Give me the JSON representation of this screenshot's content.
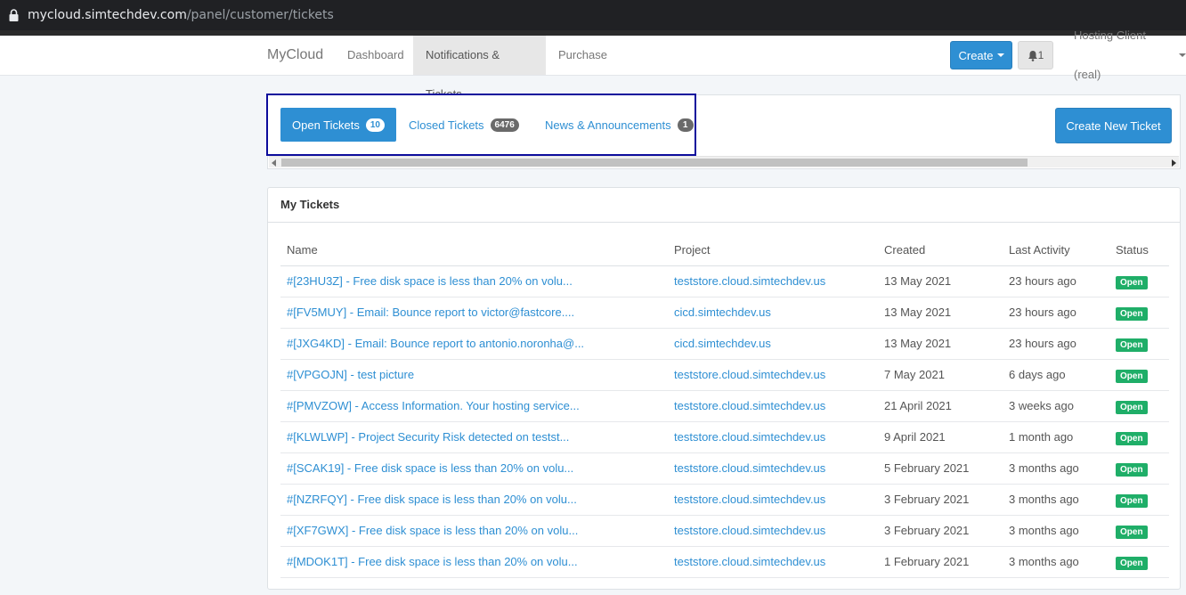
{
  "browser": {
    "url_host": "mycloud.simtechdev.com",
    "url_path": "/panel/customer/tickets"
  },
  "nav": {
    "brand": "MyCloud",
    "links": [
      "Dashboard",
      "Notifications & Tickets",
      "Purchase"
    ],
    "active_link": "Notifications & Tickets",
    "create_label": "Create",
    "bell_count": "1",
    "user_label": "Hosting Client (real)"
  },
  "tabs": {
    "items": [
      {
        "label": "Open Tickets",
        "count": "10",
        "active": true
      },
      {
        "label": "Closed Tickets",
        "count": "6476",
        "active": false
      },
      {
        "label": "News & Announcements",
        "count": "1",
        "active": false
      }
    ],
    "new_ticket_label": "Create New Ticket"
  },
  "tickets": {
    "heading": "My Tickets",
    "columns": [
      "Name",
      "Project",
      "Created",
      "Last Activity",
      "Status"
    ],
    "rows": [
      {
        "name": "#[23HU3Z] - Free disk space is less than 20% on volu...",
        "project": "teststore.cloud.simtechdev.us",
        "created": "13 May 2021",
        "last_activity": "23 hours ago",
        "status": "Open"
      },
      {
        "name": "#[FV5MUY] - Email: Bounce report to victor@fastcore....",
        "project": "cicd.simtechdev.us",
        "created": "13 May 2021",
        "last_activity": "23 hours ago",
        "status": "Open"
      },
      {
        "name": "#[JXG4KD] - Email: Bounce report to antonio.noronha@...",
        "project": "cicd.simtechdev.us",
        "created": "13 May 2021",
        "last_activity": "23 hours ago",
        "status": "Open"
      },
      {
        "name": "#[VPGOJN] - test picture",
        "project": "teststore.cloud.simtechdev.us",
        "created": "7 May 2021",
        "last_activity": "6 days ago",
        "status": "Open"
      },
      {
        "name": "#[PMVZOW] - Access Information. Your hosting service...",
        "project": "teststore.cloud.simtechdev.us",
        "created": "21 April 2021",
        "last_activity": "3 weeks ago",
        "status": "Open"
      },
      {
        "name": "#[KLWLWP] - Project Security Risk detected on testst...",
        "project": "teststore.cloud.simtechdev.us",
        "created": "9 April 2021",
        "last_activity": "1 month ago",
        "status": "Open"
      },
      {
        "name": "#[SCAK19] - Free disk space is less than 20% on volu...",
        "project": "teststore.cloud.simtechdev.us",
        "created": "5 February 2021",
        "last_activity": "3 months ago",
        "status": "Open"
      },
      {
        "name": "#[NZRFQY] - Free disk space is less than 20% on volu...",
        "project": "teststore.cloud.simtechdev.us",
        "created": "3 February 2021",
        "last_activity": "3 months ago",
        "status": "Open"
      },
      {
        "name": "#[XF7GWX] - Free disk space is less than 20% on volu...",
        "project": "teststore.cloud.simtechdev.us",
        "created": "3 February 2021",
        "last_activity": "3 months ago",
        "status": "Open"
      },
      {
        "name": "#[MDOK1T] - Free disk space is less than 20% on volu...",
        "project": "teststore.cloud.simtechdev.us",
        "created": "1 February 2021",
        "last_activity": "3 months ago",
        "status": "Open"
      }
    ]
  },
  "colors": {
    "accent": "#2e8fd3",
    "status_open": "#1fae68",
    "highlight_border": "#0c0c9c"
  }
}
